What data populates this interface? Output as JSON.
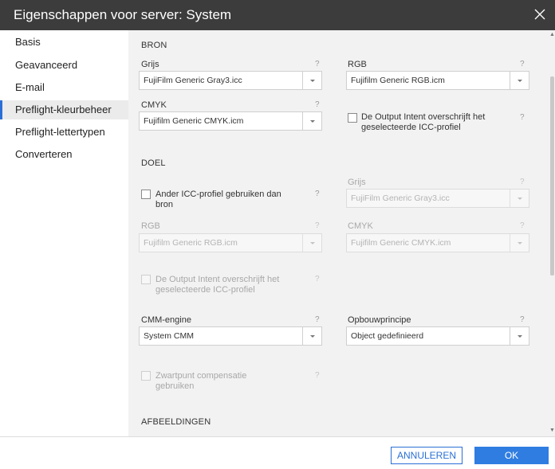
{
  "window": {
    "title": "Eigenschappen voor server: System"
  },
  "sidebar": {
    "items": [
      {
        "label": "Basis"
      },
      {
        "label": "Geavanceerd"
      },
      {
        "label": "E-mail"
      },
      {
        "label": "Preflight-kleurbeheer"
      },
      {
        "label": "Preflight-lettertypen"
      },
      {
        "label": "Converteren"
      }
    ],
    "active_index": 3
  },
  "bron": {
    "heading": "BRON",
    "grijs": {
      "label": "Grijs",
      "help": "?",
      "value": "FujiFilm Generic Gray3.icc"
    },
    "rgb": {
      "label": "RGB",
      "help": "?",
      "value": "Fujifilm Generic RGB.icm"
    },
    "cmyk": {
      "label": "CMYK",
      "help": "?",
      "value": "Fujifilm Generic CMYK.icm"
    },
    "output_intent": {
      "label": "De Output Intent overschrijft het geselecteerde ICC-profiel",
      "help": "?",
      "checked": false
    }
  },
  "doel": {
    "heading": "DOEL",
    "ander_icc": {
      "label": "Ander ICC-profiel gebruiken dan bron",
      "help": "?",
      "checked": false
    },
    "grijs": {
      "label": "Grijs",
      "help": "?",
      "value": "FujiFilm Generic Gray3.icc"
    },
    "rgb": {
      "label": "RGB",
      "help": "?",
      "value": "Fujifilm Generic RGB.icm"
    },
    "cmyk": {
      "label": "CMYK",
      "help": "?",
      "value": "Fujifilm Generic CMYK.icm"
    },
    "output_intent": {
      "label": "De Output Intent overschrijft het geselecteerde ICC-profiel",
      "help": "?",
      "checked": false
    },
    "cmm_engine": {
      "label": "CMM-engine",
      "help": "?",
      "value": "System CMM"
    },
    "opbouwprincipe": {
      "label": "Opbouwprincipe",
      "help": "?",
      "value": "Object gedefinieerd"
    },
    "zwartpunt": {
      "label": "Zwartpunt compensatie gebruiken",
      "help": "?",
      "checked": false
    }
  },
  "afbeeldingen": {
    "heading": "AFBEELDINGEN"
  },
  "footer": {
    "cancel_label": "ANNULEREN",
    "ok_label": "OK"
  },
  "colors": {
    "accent": "#2f7de1",
    "titlebar": "#3c3c3c",
    "panel": "#f2f2f2"
  }
}
